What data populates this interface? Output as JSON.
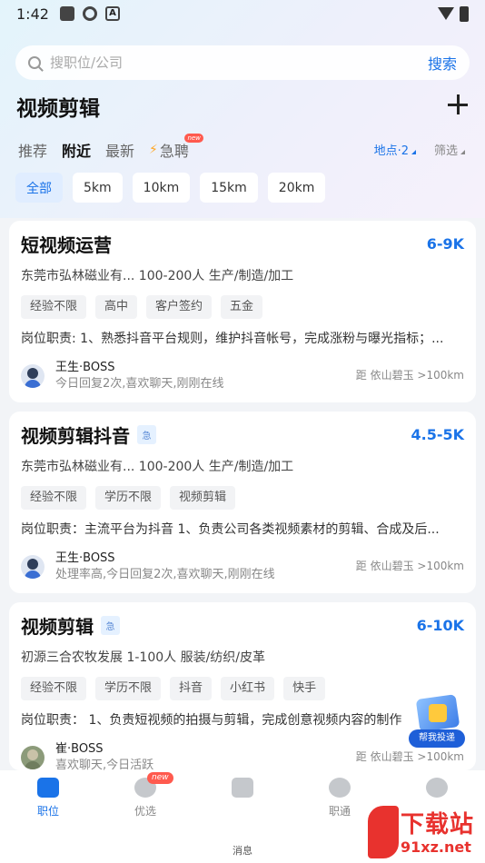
{
  "status_bar": {
    "time": "1:42"
  },
  "search": {
    "placeholder": "搜职位/公司",
    "button": "搜索"
  },
  "header": {
    "title": "视频剪辑"
  },
  "filters": {
    "tabs": [
      "推荐",
      "附近",
      "最新",
      "急聘"
    ],
    "active_tab": "附近",
    "urgent_new_tag": "new",
    "location": "地点·2",
    "screen": "筛选"
  },
  "distance_chips": [
    "全部",
    "5km",
    "10km",
    "15km",
    "20km"
  ],
  "jobs": [
    {
      "title": "短视频运营",
      "urgent": "",
      "salary": "6-9K",
      "company_line": "东莞市弘林磁业有...   100-200人   生产/制造/加工",
      "tags": [
        "经验不限",
        "高中",
        "客户签约",
        "五金"
      ],
      "duty": "岗位职责: 1、熟悉抖音平台规则，维护抖音帐号，完成涨粉与曝光指标；...",
      "recruiter": "王生·BOSS",
      "status": "今日回复2次,喜欢聊天,刚刚在线",
      "distance": "距 依山碧玉 >100km"
    },
    {
      "title": "视频剪辑抖音",
      "urgent": "急",
      "salary": "4.5-5K",
      "company_line": "东莞市弘林磁业有...   100-200人   生产/制造/加工",
      "tags": [
        "经验不限",
        "学历不限",
        "视频剪辑"
      ],
      "duty": "岗位职责：主流平台为抖音 1、负责公司各类视频素材的剪辑、合成及后...",
      "recruiter": "王生·BOSS",
      "status": "处理率高,今日回复2次,喜欢聊天,刚刚在线",
      "distance": "距 依山碧玉 >100km"
    },
    {
      "title": "视频剪辑",
      "urgent": "急",
      "salary": "6-10K",
      "company_line": "初源三合农牧发展   1-100人   服装/纺织/皮革",
      "tags": [
        "经验不限",
        "学历不限",
        "抖音",
        "小红书",
        "快手"
      ],
      "duty": "岗位职责：   1、负责短视频的拍摄与剪辑，完成创意视频内容的制作",
      "recruiter": "崔·BOSS",
      "status": "喜欢聊天,今日活跃",
      "distance": "距 依山碧玉 >100km"
    }
  ],
  "float_badge": {
    "label": "帮我投递"
  },
  "bottom_nav": {
    "items": [
      "职位",
      "优选",
      "",
      "职通",
      ""
    ],
    "new_tag": "new",
    "message_label": "消息"
  },
  "watermark": {
    "text": "下载站",
    "sub": "91xz.net"
  },
  "colors": {
    "accent": "#1a73e8",
    "new_badge": "#ff5a4e",
    "watermark": "#e8322e"
  }
}
